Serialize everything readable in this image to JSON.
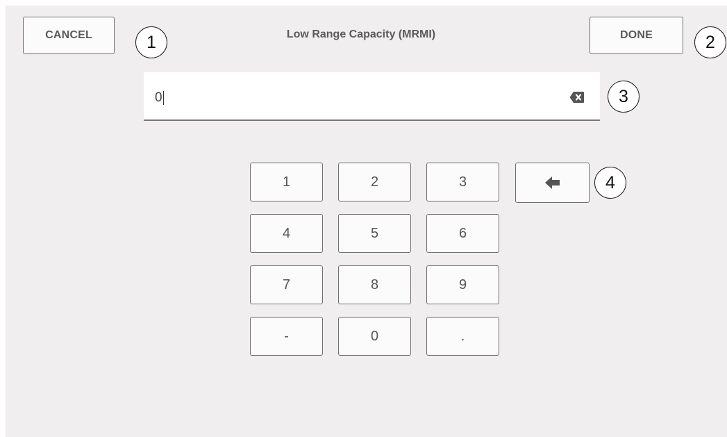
{
  "header": {
    "cancel_label": "CANCEL",
    "title": "Low Range Capacity (MRMI)",
    "done_label": "DONE"
  },
  "field": {
    "value": "0",
    "clear_icon": "backspace-icon"
  },
  "keypad": {
    "keys": [
      {
        "label": "1",
        "id": "key-1"
      },
      {
        "label": "2",
        "id": "key-2"
      },
      {
        "label": "3",
        "id": "key-3"
      },
      {
        "label": "4",
        "id": "key-4"
      },
      {
        "label": "5",
        "id": "key-5"
      },
      {
        "label": "6",
        "id": "key-6"
      },
      {
        "label": "7",
        "id": "key-7"
      },
      {
        "label": "8",
        "id": "key-8"
      },
      {
        "label": "9",
        "id": "key-9"
      },
      {
        "label": "-",
        "id": "key-minus"
      },
      {
        "label": "0",
        "id": "key-0"
      },
      {
        "label": ".",
        "id": "key-decimal"
      }
    ],
    "back_icon": "arrow-left-icon"
  },
  "callouts": [
    "1",
    "2",
    "3",
    "4"
  ],
  "colors": {
    "panel_background": "#f0eeef",
    "button_border": "#6f6f6f",
    "button_text": "#5a5a5a",
    "field_underline": "#777777"
  }
}
